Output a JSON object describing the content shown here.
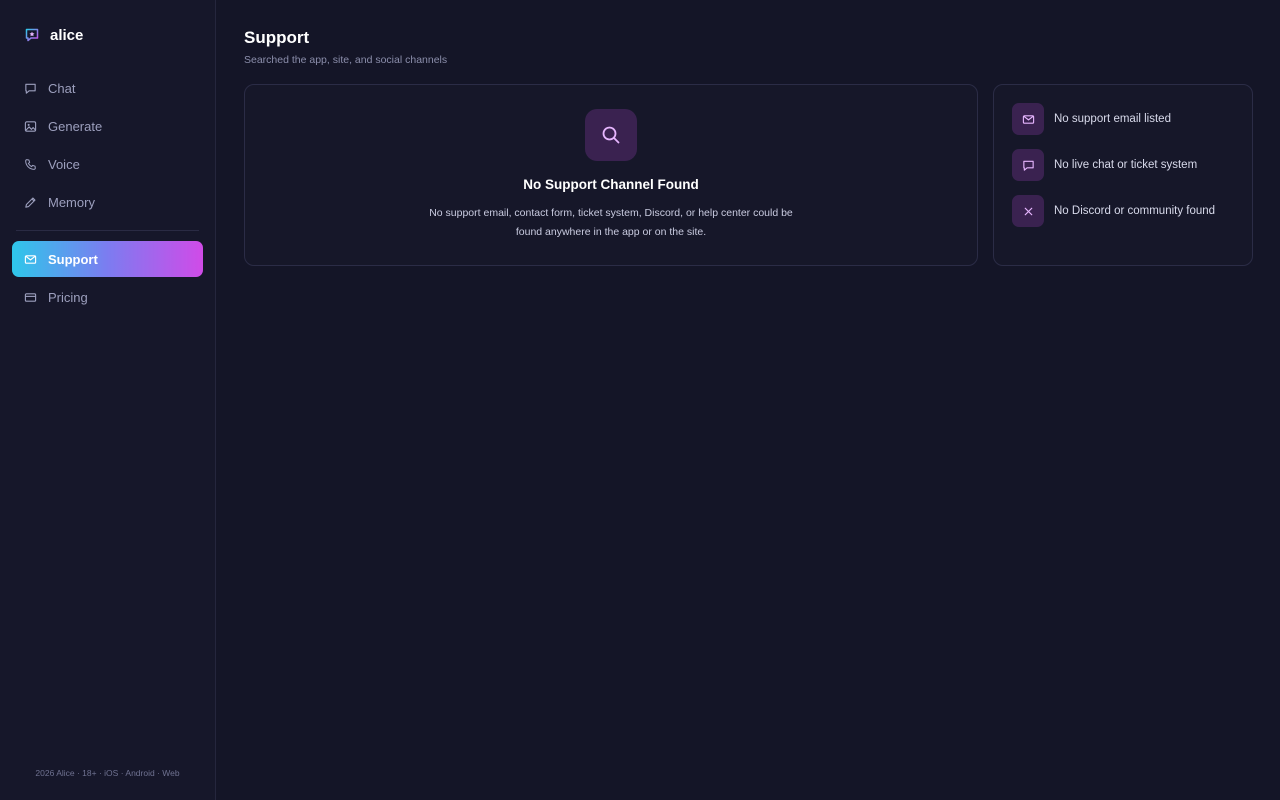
{
  "brand": {
    "name": "alice",
    "icon": "chat-star-icon"
  },
  "sidebar": {
    "items": [
      {
        "label": "Chat",
        "icon": "chat-bubble-icon",
        "active": false
      },
      {
        "label": "Generate",
        "icon": "image-icon",
        "active": false
      },
      {
        "label": "Voice",
        "icon": "phone-icon",
        "active": false
      },
      {
        "label": "Memory",
        "icon": "pencil-icon",
        "active": false
      },
      {
        "label": "Support",
        "icon": "mail-icon",
        "active": true
      },
      {
        "label": "Pricing",
        "icon": "card-icon",
        "active": false
      }
    ],
    "footer": "2026 Alice · 18+ · iOS · Android · Web"
  },
  "page": {
    "title": "Support",
    "subtitle": "Searched the app, site, and social channels"
  },
  "empty_state": {
    "icon": "search-icon",
    "title": "No Support Channel Found",
    "description": "No support email, contact form, ticket system, Discord, or help center could be found anywhere in the app or on the site."
  },
  "status_list": [
    {
      "icon": "mail-icon",
      "text": "No support email listed"
    },
    {
      "icon": "chat-bubble-icon",
      "text": "No live chat or ticket system"
    },
    {
      "icon": "close-icon",
      "text": "No Discord or community found"
    }
  ],
  "colors": {
    "background": "#141527",
    "sidebar": "#16172a",
    "accent_start": "#2ec7ea",
    "accent_end": "#d04be8",
    "icon_tile": "#3a2250"
  }
}
